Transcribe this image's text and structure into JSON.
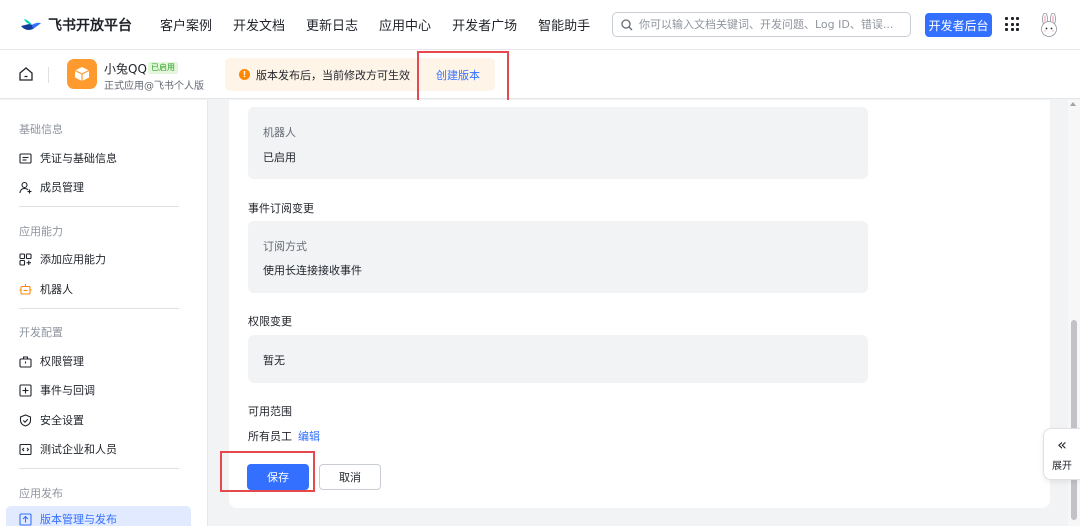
{
  "topbar": {
    "logo_text": "飞书开放平台",
    "nav": [
      "客户案例",
      "开发文档",
      "更新日志",
      "应用中心",
      "开发者广场",
      "智能助手"
    ],
    "search_placeholder": "你可以输入文档关键词、开发问题、Log ID、错误...",
    "dev_console_label": "开发者后台"
  },
  "app": {
    "name": "小兔QQ",
    "status_badge": "已启用",
    "subtitle": "正式应用@飞书个人版",
    "notice_text": "版本发布后，当前修改方可生效",
    "create_version_label": "创建版本"
  },
  "sidebar": {
    "sections": [
      {
        "title": "基础信息",
        "items": [
          "凭证与基础信息",
          "成员管理"
        ]
      },
      {
        "title": "应用能力",
        "items": [
          "添加应用能力",
          "机器人"
        ]
      },
      {
        "title": "开发配置",
        "items": [
          "权限管理",
          "事件与回调",
          "安全设置",
          "测试企业和人员"
        ]
      },
      {
        "title": "应用发布",
        "items": [
          "版本管理与发布"
        ]
      }
    ]
  },
  "content": {
    "bot_label": "机器人",
    "bot_value": "已启用",
    "event_section": "事件订阅变更",
    "event_label": "订阅方式",
    "event_value": "使用长连接接收事件",
    "perm_section": "权限变更",
    "perm_value": "暂无",
    "scope_section": "可用范围",
    "scope_value": "所有员工",
    "scope_edit": "编辑",
    "save_label": "保存",
    "cancel_label": "取消"
  },
  "expand_label": "展开",
  "colors": {
    "accent": "#3370ff",
    "warning": "#ff8800",
    "highlight_box": "#e5484d"
  }
}
